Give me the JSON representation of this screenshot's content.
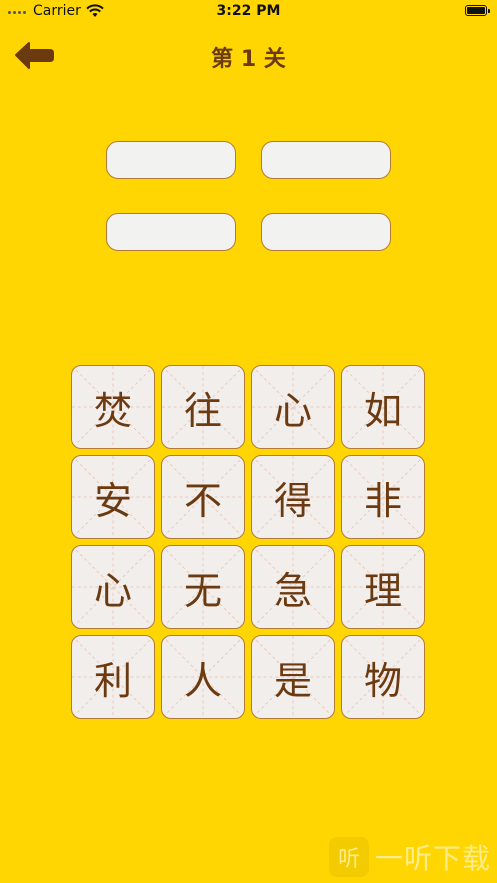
{
  "status_bar": {
    "carrier": "Carrier",
    "time": "3:22 PM"
  },
  "nav": {
    "title": "第 1 关",
    "back_icon": "arrow-left-icon"
  },
  "answer_slots": [
    "",
    "",
    "",
    ""
  ],
  "tiles": [
    "焚",
    "往",
    "心",
    "如",
    "安",
    "不",
    "得",
    "非",
    "心",
    "无",
    "急",
    "理",
    "利",
    "人",
    "是",
    "物"
  ],
  "watermark": {
    "logo_glyph": "听",
    "text": "一听下载"
  },
  "colors": {
    "background": "#FFD602",
    "accent_brown": "#6B3A10",
    "tile_fill": "#F2EEEC",
    "tile_border": "#B07A3A"
  }
}
